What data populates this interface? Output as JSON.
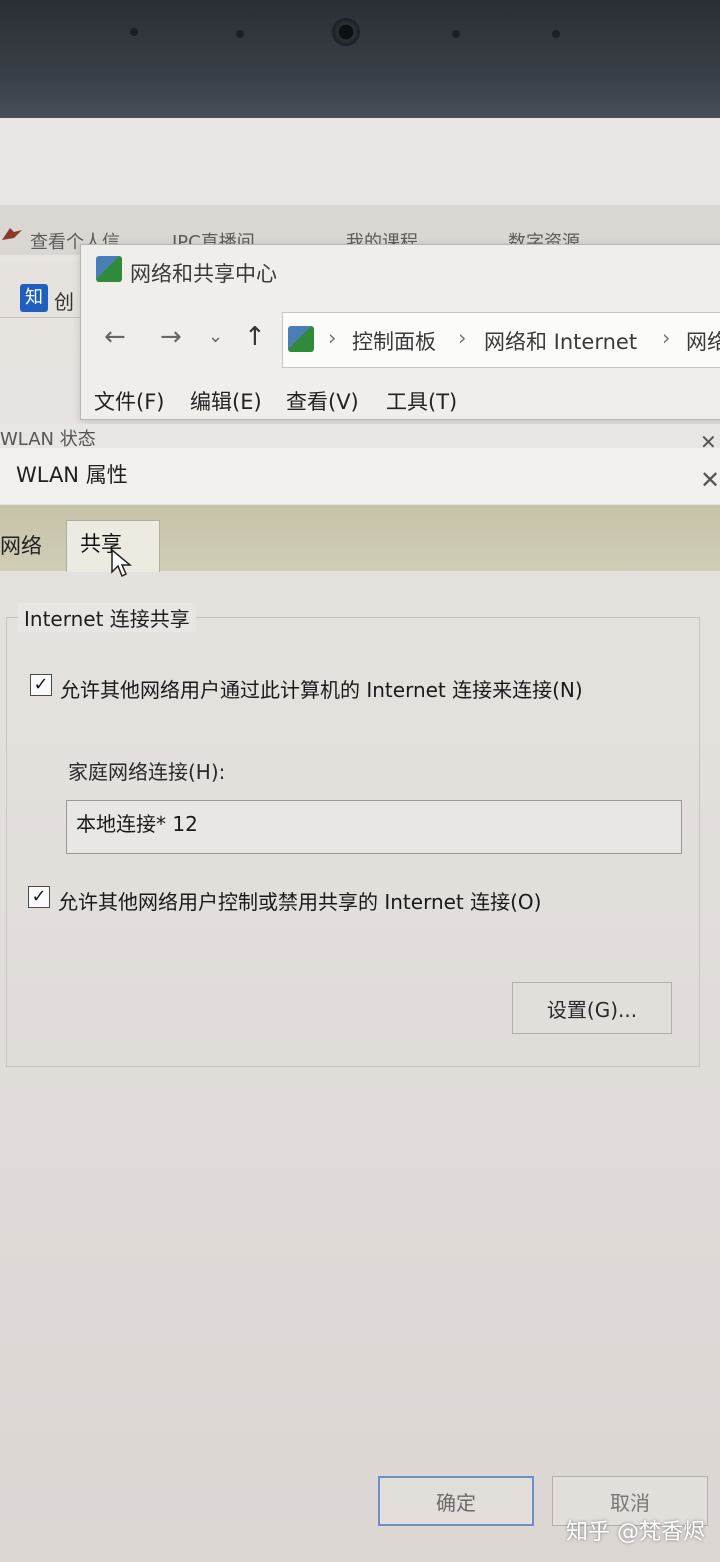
{
  "browser": {
    "bookmarks": [
      "查看个人信",
      "IPC直播间",
      "我的课程",
      "数字资源"
    ],
    "tab_label": "创"
  },
  "network_center": {
    "title": "网络和共享中心",
    "breadcrumbs": [
      "控制面板",
      "网络和 Internet",
      "网络"
    ],
    "menu": [
      "文件(F)",
      "编辑(E)",
      "查看(V)",
      "工具(T)"
    ]
  },
  "wlan_status": {
    "title": "WLAN 状态"
  },
  "dialog": {
    "title": "WLAN 属性",
    "tabs": [
      "网络",
      "共享"
    ],
    "active_tab": "共享",
    "group_title": "Internet 连接共享",
    "allow_connect": {
      "label": "允许其他网络用户通过此计算机的 Internet 连接来连接(N)",
      "checked": true
    },
    "home_connection": {
      "label": "家庭网络连接(H):",
      "value": "本地连接* 12"
    },
    "allow_control": {
      "label": "允许其他网络用户控制或禁用共享的 Internet 连接(O)",
      "checked": true
    },
    "settings_button": "设置(G)...",
    "ok_button": "确定",
    "cancel_button": "取消"
  },
  "watermark": "知乎 @梵香烬",
  "colors": {
    "bezel": "#2a2f35",
    "tab_strip": "#c7c3a8",
    "ok_border": "#6d8fc7"
  }
}
